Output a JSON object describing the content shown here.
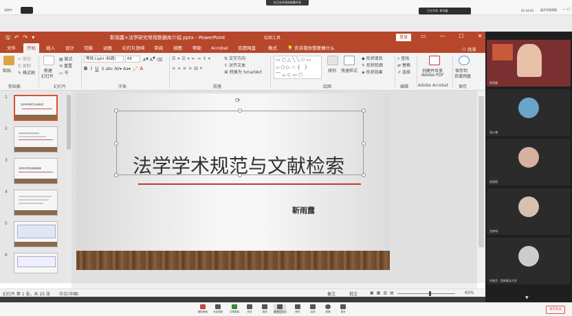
{
  "meeting": {
    "title_pill": "在正在共享的屏幕共享",
    "recording": "录制中",
    "sharer": "正在共享: 靳雨露",
    "time": "01:24:03",
    "view_label": "展开列表视图",
    "end_button": "离开会议",
    "toolbar": [
      {
        "label": "解除静音",
        "icon": "mic-icon"
      },
      {
        "label": "开启视频",
        "icon": "camera-icon"
      },
      {
        "label": "共享屏幕",
        "icon": "share-screen-icon"
      },
      {
        "label": "安全",
        "icon": "shield-icon"
      },
      {
        "label": "邀请",
        "icon": "invite-icon"
      },
      {
        "label": "管理成员(6)",
        "icon": "members-icon"
      },
      {
        "label": "聊天",
        "icon": "chat-icon"
      },
      {
        "label": "应用",
        "icon": "apps-icon"
      },
      {
        "label": "表情",
        "icon": "emoji-icon"
      },
      {
        "label": "更多",
        "icon": "more-icon"
      }
    ]
  },
  "participants": [
    {
      "name": "靳雨露",
      "avatar_color": "#e8c0a8"
    },
    {
      "name": "张沙澜",
      "avatar_color": "#6aa4c8"
    },
    {
      "name": "赵丽丽",
      "avatar_color": "#d8b0a0"
    },
    {
      "name": "沈梦琪",
      "avatar_color": "#d6c1b0"
    },
    {
      "name": "刘淑芳 · 西南政法大学",
      "avatar_color": "#cccccc"
    }
  ],
  "ppt": {
    "doc_title": "靳雨露+法学研究常用数据库介绍.pptx  -  PowerPoint",
    "context_tools": "绘图工具",
    "login": "登录",
    "share": "共享",
    "tellme": "告诉我你想要做什么",
    "tabs": [
      "文件",
      "开始",
      "插入",
      "设计",
      "切换",
      "动画",
      "幻灯片放映",
      "审阅",
      "视图",
      "帮助",
      "Acrobat",
      "百度网盘",
      "格式"
    ],
    "ribbon": {
      "paste": "粘贴",
      "cut": "剪切",
      "copy": "复制",
      "format_painter": "格式刷",
      "new_slide": "新建",
      "new_slide2": "幻灯片",
      "layout": "版式",
      "reset": "重置",
      "section": "节",
      "font_name": "等线 Light (标题)",
      "font_size": "66",
      "text_direction": "文字方向",
      "align_text": "对齐文本",
      "smartart": "转换为 SmartArt",
      "arrange": "排列",
      "quick_styles": "快速样式",
      "shape_fill": "形状填充",
      "shape_outline": "形状轮廓",
      "shape_effects": "形状效果",
      "find": "查找",
      "replace": "替换",
      "select": "选择",
      "create_pdf": "创建并共享",
      "create_pdf2": "Adobe PDF",
      "save_baidu": "保存到",
      "save_baidu2": "百度网盘",
      "groups": [
        "剪贴板",
        "幻灯片",
        "字体",
        "段落",
        "绘图",
        "编辑",
        "Adobe Acrobat",
        "保存"
      ]
    },
    "slides": [
      {
        "num": "1",
        "text": "法学学术规范与文献检索"
      },
      {
        "num": "2",
        "text": ""
      },
      {
        "num": "3",
        "text": "法学学术研究常用数据库"
      },
      {
        "num": "4",
        "text": ""
      },
      {
        "num": "5",
        "text": ""
      },
      {
        "num": "6",
        "text": ""
      }
    ],
    "slide_title": "法学学术规范与文献检索",
    "slide_author": "靳雨露",
    "status": {
      "slide_count": "幻灯片 第 1 张，共 25 张",
      "language": "中文(中国)",
      "notes": "备注",
      "comments": "批注",
      "zoom": "65%"
    }
  }
}
